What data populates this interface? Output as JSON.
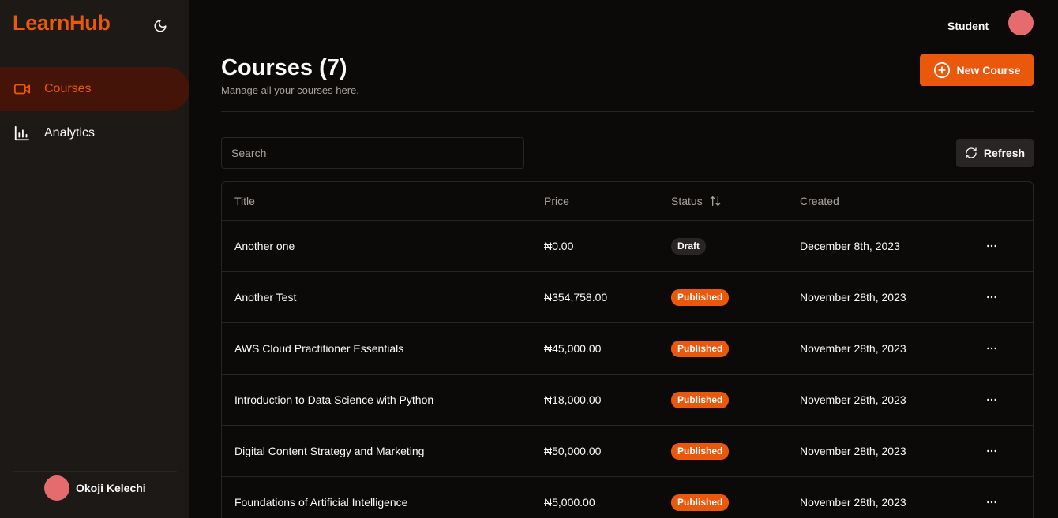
{
  "app": {
    "logo": "LearnHub"
  },
  "sidebar": {
    "items": [
      {
        "label": "Courses",
        "icon": "video-icon",
        "active": true
      },
      {
        "label": "Analytics",
        "icon": "bar-chart-icon",
        "active": false
      }
    ],
    "user_name": "Okoji Kelechi"
  },
  "topbar": {
    "role": "Student"
  },
  "page": {
    "title": "Courses (7)",
    "subtitle": "Manage all your courses here.",
    "new_button": "New Course"
  },
  "toolbar": {
    "search_placeholder": "Search",
    "refresh_label": "Refresh"
  },
  "table": {
    "columns": [
      "Title",
      "Price",
      "Status",
      "Created"
    ],
    "rows": [
      {
        "title": "Another one",
        "price": "₦0.00",
        "status": "Draft",
        "created": "December 8th, 2023"
      },
      {
        "title": "Another Test",
        "price": "₦354,758.00",
        "status": "Published",
        "created": "November 28th, 2023"
      },
      {
        "title": "AWS Cloud Practitioner Essentials",
        "price": "₦45,000.00",
        "status": "Published",
        "created": "November 28th, 2023"
      },
      {
        "title": "Introduction to Data Science with Python",
        "price": "₦18,000.00",
        "status": "Published",
        "created": "November 28th, 2023"
      },
      {
        "title": "Digital Content Strategy and Marketing",
        "price": "₦50,000.00",
        "status": "Published",
        "created": "November 28th, 2023"
      },
      {
        "title": "Foundations of Artificial Intelligence",
        "price": "₦5,000.00",
        "status": "Published",
        "created": "November 28th, 2023"
      }
    ]
  },
  "colors": {
    "accent": "#ea580c",
    "background": "#0c0a09",
    "sidebar": "#1c1917",
    "active_nav": "#431407",
    "avatar": "#e56b6f"
  }
}
